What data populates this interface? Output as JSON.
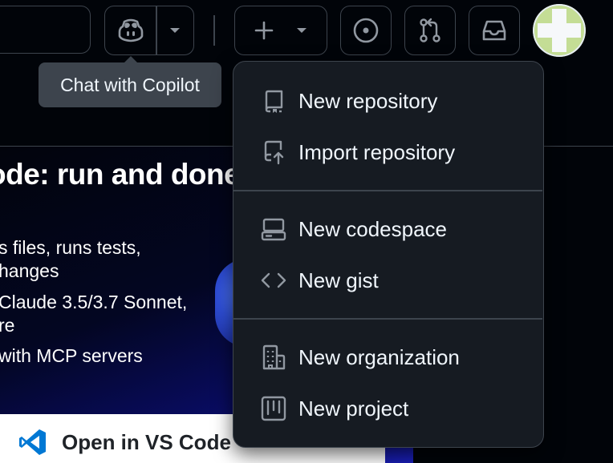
{
  "header": {
    "icons": {
      "copilot": "copilot-icon",
      "copilot_menu": "triangle-down-icon",
      "create": "plus-icon",
      "create_menu": "triangle-down-icon",
      "issues": "issue-opened-icon",
      "pull_requests": "git-pull-request-icon",
      "inbox": "inbox-icon"
    }
  },
  "tooltip": {
    "text": "Chat with Copilot"
  },
  "banner": {
    "title": "ode: run and done",
    "lines": [
      "s files, runs tests,",
      "hanges",
      "Claude 3.5/3.7 Sonnet,",
      "re",
      "with MCP servers"
    ],
    "vscode_button": "Open in VS Code"
  },
  "create_menu": {
    "items": [
      {
        "label": "New repository",
        "icon": "repo-icon"
      },
      {
        "label": "Import repository",
        "icon": "repo-push-icon"
      },
      {
        "label": "New codespace",
        "icon": "codespaces-icon"
      },
      {
        "label": "New gist",
        "icon": "code-icon"
      },
      {
        "label": "New organization",
        "icon": "organization-icon"
      },
      {
        "label": "New project",
        "icon": "table-icon"
      }
    ]
  },
  "colors": {
    "background": "#010409",
    "border": "#3d444d",
    "menu_bg": "#161b22",
    "text": "#f0f6fc",
    "icon": "#9198a1",
    "vscode_blue": "#0078d4"
  }
}
